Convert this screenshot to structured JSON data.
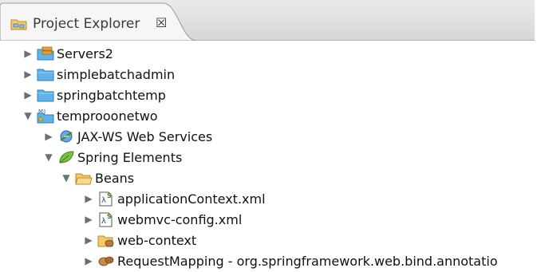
{
  "tab": {
    "title": "Project Explorer",
    "close_glyph": "☒",
    "icon": "folder-tree-icon"
  },
  "tree": [
    {
      "label": "Servers2",
      "icon": "servers-folder-icon",
      "expanded": false
    },
    {
      "label": "simplebatchadmin",
      "icon": "folder-icon",
      "expanded": false
    },
    {
      "label": "springbatchtemp",
      "icon": "folder-icon",
      "expanded": false
    },
    {
      "label": "temprooonetwo",
      "icon": "maven-project-icon",
      "expanded": true
    },
    {
      "label": "JAX-WS Web Services",
      "icon": "web-services-icon",
      "expanded": false
    },
    {
      "label": "Spring Elements",
      "icon": "spring-leaf-icon",
      "expanded": true
    },
    {
      "label": "Beans",
      "icon": "beans-folder-icon",
      "expanded": true
    },
    {
      "label": "applicationContext.xml",
      "icon": "spring-config-file-icon",
      "expanded": false
    },
    {
      "label": "webmvc-config.xml",
      "icon": "spring-config-file-icon",
      "expanded": false
    },
    {
      "label": "web-context",
      "icon": "bean-folder-icon",
      "expanded": false
    },
    {
      "label": "RequestMapping - org.springframework.web.bind.annotatio",
      "icon": "bean-icon",
      "expanded": false
    }
  ],
  "colors": {
    "folder_blue": "#5fb3e8",
    "tab_bg": "#f4f4f4",
    "arrow": "#6f6f6f"
  }
}
